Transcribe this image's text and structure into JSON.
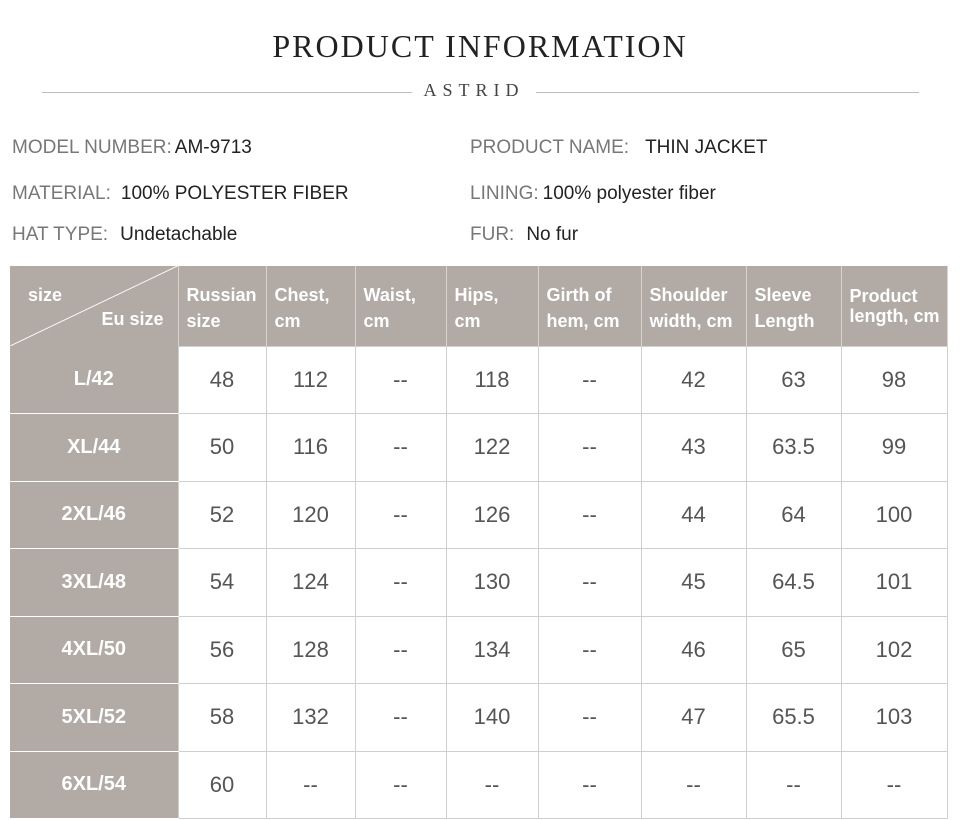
{
  "header": {
    "title": "PRODUCT INFORMATION",
    "brand": "ASTRID"
  },
  "info": {
    "model_label": "MODEL NUMBER:",
    "model_value": "AM-9713",
    "name_label": "PRODUCT NAME:",
    "name_value": "THIN JACKET",
    "material_label": "MATERIAL:",
    "material_value": "100% POLYESTER FIBER",
    "lining_label": "LINING:",
    "lining_value": "100% polyester fiber",
    "hat_label": "HAT TYPE:",
    "hat_value": "Undetachable",
    "fur_label": "FUR:",
    "fur_value": "No fur"
  },
  "table": {
    "corner_top": "size",
    "corner_bottom": "Eu size",
    "columns": [
      [
        "Russian",
        "size"
      ],
      [
        "Chest,",
        "cm"
      ],
      [
        "Waist,",
        "cm"
      ],
      [
        "Hips,",
        "cm"
      ],
      [
        "Girth of",
        "hem, cm"
      ],
      [
        "Shoulder",
        "width, cm"
      ],
      [
        "Sleeve",
        "Length"
      ],
      [
        "Product",
        "length, cm"
      ]
    ],
    "rows": [
      [
        "L/42",
        "48",
        "112",
        "--",
        "118",
        "--",
        "42",
        "63",
        "98"
      ],
      [
        "XL/44",
        "50",
        "116",
        "--",
        "122",
        "--",
        "43",
        "63.5",
        "99"
      ],
      [
        "2XL/46",
        "52",
        "120",
        "--",
        "126",
        "--",
        "44",
        "64",
        "100"
      ],
      [
        "3XL/48",
        "54",
        "124",
        "--",
        "130",
        "--",
        "45",
        "64.5",
        "101"
      ],
      [
        "4XL/50",
        "56",
        "128",
        "--",
        "134",
        "--",
        "46",
        "65",
        "102"
      ],
      [
        "5XL/52",
        "58",
        "132",
        "--",
        "140",
        "--",
        "47",
        "65.5",
        "103"
      ],
      [
        "6XL/54",
        "60",
        "--",
        "--",
        "--",
        "--",
        "--",
        "--",
        "--"
      ]
    ]
  }
}
